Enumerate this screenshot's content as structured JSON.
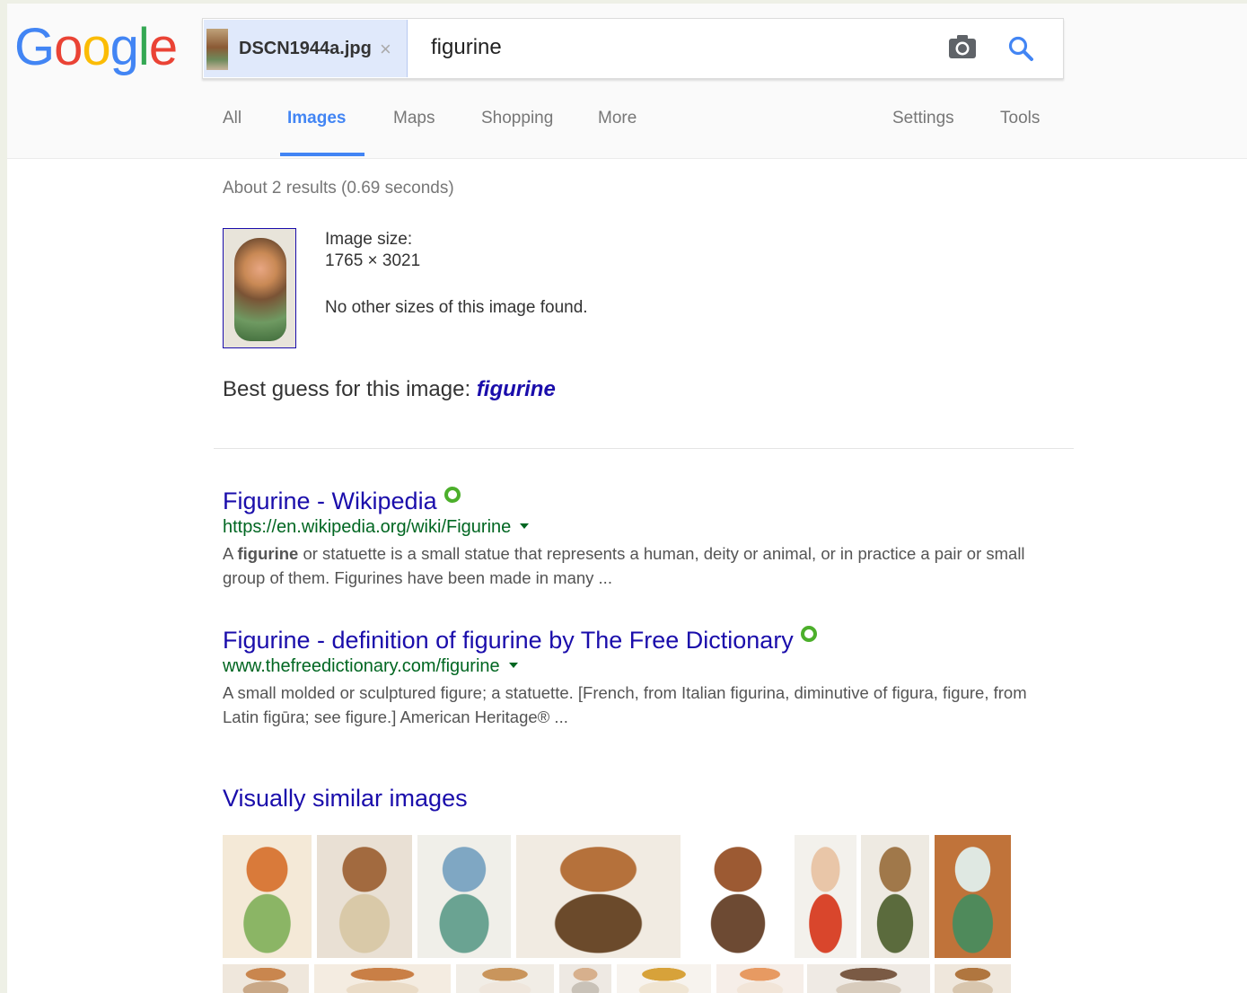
{
  "logo": {
    "text": "Google",
    "letters": [
      "G",
      "o",
      "o",
      "g",
      "l",
      "e"
    ],
    "colors": [
      "#4285f4",
      "#ea4335",
      "#fbbc05",
      "#4285f4",
      "#34a853",
      "#ea4335"
    ]
  },
  "search": {
    "image_chip": {
      "filename": "DSCN1944a.jpg",
      "close_label": "×"
    },
    "query": "figurine",
    "camera_icon": "camera-icon",
    "search_icon": "search-icon"
  },
  "nav": {
    "tabs": [
      {
        "label": "All",
        "active": false
      },
      {
        "label": "Images",
        "active": true
      },
      {
        "label": "Maps",
        "active": false
      },
      {
        "label": "Shopping",
        "active": false
      },
      {
        "label": "More",
        "active": false
      }
    ],
    "settings_label": "Settings",
    "tools_label": "Tools"
  },
  "stats": "About 2 results (0.69 seconds)",
  "image_info": {
    "size_label": "Image size:",
    "size_value": "1765 × 3021",
    "other_sizes": "No other sizes of this image found."
  },
  "best_guess": {
    "label": "Best guess for this image:",
    "value": "figurine"
  },
  "results": [
    {
      "title": "Figurine - Wikipedia",
      "url": "https://en.wikipedia.org/wiki/Figurine",
      "snippet_bold": "figurine",
      "snippet_pre": "A ",
      "snippet_post": " or statuette is a small statue that represents a human, deity or animal, or in practice a pair or small group of them. Figurines have been made in many ..."
    },
    {
      "title": "Figurine - definition of figurine by The Free Dictionary",
      "url": "www.thefreedictionary.com/figurine",
      "snippet_bold": "",
      "snippet_pre": "A small molded or sculptured figure; a statuette. [French, from Italian figurina, diminutive of figura, figure, from Latin figūra; see figure.] American Heritage® ...",
      "snippet_post": ""
    }
  ],
  "visually_similar": {
    "heading": "Visually similar images",
    "tiles": [
      {
        "colors": [
          "#f4e9d7",
          "#d97a3a",
          "#8bb565"
        ]
      },
      {
        "colors": [
          "#e9e0d4",
          "#a26a3f",
          "#d9c9a8"
        ]
      },
      {
        "colors": [
          "#f0efe9",
          "#7fa7c3",
          "#6aa392"
        ]
      },
      {
        "colors": [
          "#f1ebe2",
          "#b5713b",
          "#6b4a2b"
        ]
      },
      {
        "colors": [
          "#ffffff",
          "#9c5a33",
          "#6d4a33"
        ]
      },
      {
        "colors": [
          "#f3f1ec",
          "#e9c6a8",
          "#d9462c"
        ]
      },
      {
        "colors": [
          "#eeeae2",
          "#a0784a",
          "#5b6b3d"
        ]
      },
      {
        "colors": [
          "#c0733a",
          "#dfe8e2",
          "#4f8a5b"
        ]
      },
      {
        "colors": [
          "#efe7dc",
          "#c9864e",
          "#c9a887"
        ]
      },
      {
        "colors": [
          "#f4ece1",
          "#c97f46",
          "#eadbc6"
        ]
      },
      {
        "colors": [
          "#f1ede6",
          "#c9955c",
          "#efe6dc"
        ]
      },
      {
        "colors": [
          "#eee9e3",
          "#d7b08d",
          "#c9c2b8"
        ]
      },
      {
        "colors": [
          "#f7f3ee",
          "#d7a23a",
          "#f0e5d3"
        ]
      },
      {
        "colors": [
          "#f6eee8",
          "#e79a62",
          "#f2e5d8"
        ]
      },
      {
        "colors": [
          "#efeae4",
          "#7a5a44",
          "#d8ccbd"
        ]
      },
      {
        "colors": [
          "#efe7dc",
          "#b0763f",
          "#d8c6ae"
        ]
      }
    ]
  }
}
